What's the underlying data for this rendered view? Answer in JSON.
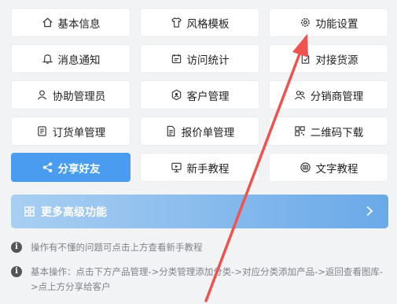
{
  "grid": [
    {
      "label": "基本信息",
      "icon": "home-icon",
      "active": false
    },
    {
      "label": "风格模板",
      "icon": "shirt-icon",
      "active": false
    },
    {
      "label": "功能设置",
      "icon": "gear-icon",
      "active": false
    },
    {
      "label": "消息通知",
      "icon": "bell-icon",
      "active": false
    },
    {
      "label": "访问统计",
      "icon": "calendar-icon",
      "active": false
    },
    {
      "label": "对接货源",
      "icon": "document-icon",
      "active": false
    },
    {
      "label": "协助管理员",
      "icon": "user-icon",
      "active": false
    },
    {
      "label": "客户管理",
      "icon": "badge-icon",
      "active": false
    },
    {
      "label": "分销商管理",
      "icon": "users-icon",
      "active": false
    },
    {
      "label": "订货单管理",
      "icon": "list-icon",
      "active": false
    },
    {
      "label": "报价单管理",
      "icon": "file-icon",
      "active": false
    },
    {
      "label": "二维码下载",
      "icon": "qrcode-icon",
      "active": false
    },
    {
      "label": "分享好友",
      "icon": "share-icon",
      "active": true
    },
    {
      "label": "新手教程",
      "icon": "monitor-icon",
      "active": false
    },
    {
      "label": "文字教程",
      "icon": "text-icon",
      "active": false
    }
  ],
  "banner": {
    "label": "更多高级功能",
    "icon": "apps-icon"
  },
  "notes": [
    "操作有不懂的问题可点击上方查看新手教程",
    "基本操作：点击下方产品管理->分类管理添加分类->对应分类添加产品->返回查看图库->点上方分享给客户"
  ],
  "colors": {
    "accent": "#4a9cf0",
    "background": "#f2f3f5",
    "annotation_arrow": "#ef5350"
  }
}
